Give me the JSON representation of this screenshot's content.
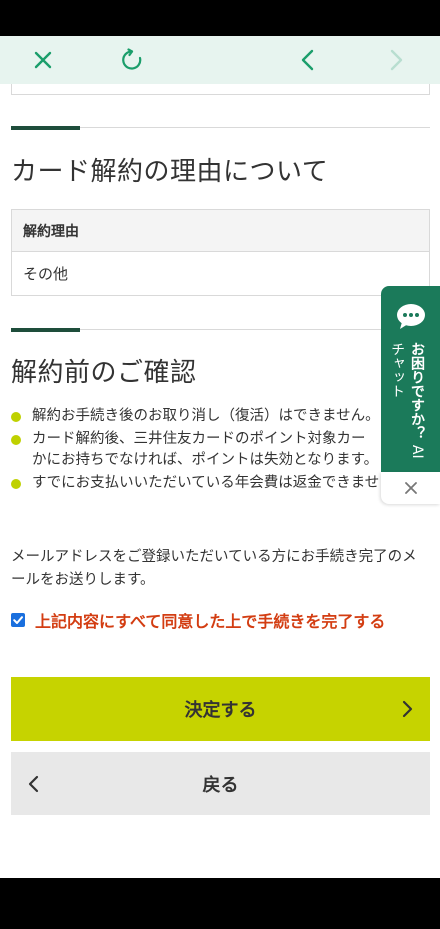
{
  "browser": {
    "icons": {
      "close": "close-icon",
      "reload": "reload-icon",
      "back": "chevron-left-icon",
      "forward": "chevron-right-icon"
    },
    "accent_color": "#1b9e6b"
  },
  "section_reason": {
    "title": "カード解約の理由について",
    "table_header": "解約理由",
    "table_value": "その他"
  },
  "section_confirm": {
    "title": "解約前のご確認",
    "bullets": [
      "解約お手続き後のお取り消し（復活）はできません。",
      "カード解約後、三井住友カードのポイント対象カー",
      "かにお持ちでなければ、ポイントは失効となります。",
      "すでにお支払いいただいている年会費は返金できませ"
    ],
    "notice_line1": "メールアドレスをご登録いただいている方にお手続き完了のメ",
    "notice_line2": "ールをお送りします。",
    "agree_label": "上記内容にすべて同意した上で手続きを完了する",
    "agree_checked": true
  },
  "buttons": {
    "submit_label": "決定する",
    "back_label": "戻る",
    "submit_color": "#c6d300"
  },
  "ai_chat": {
    "label_line1": "お困りですか？",
    "label_line2": "AIチャット",
    "icon": "chat-bubble-icon",
    "close_icon": "close-icon",
    "color": "#1b7a5a"
  },
  "colors": {
    "bullet": "#bfd100",
    "agree_text": "#d33d12",
    "section_accent": "#1e4d3b"
  }
}
